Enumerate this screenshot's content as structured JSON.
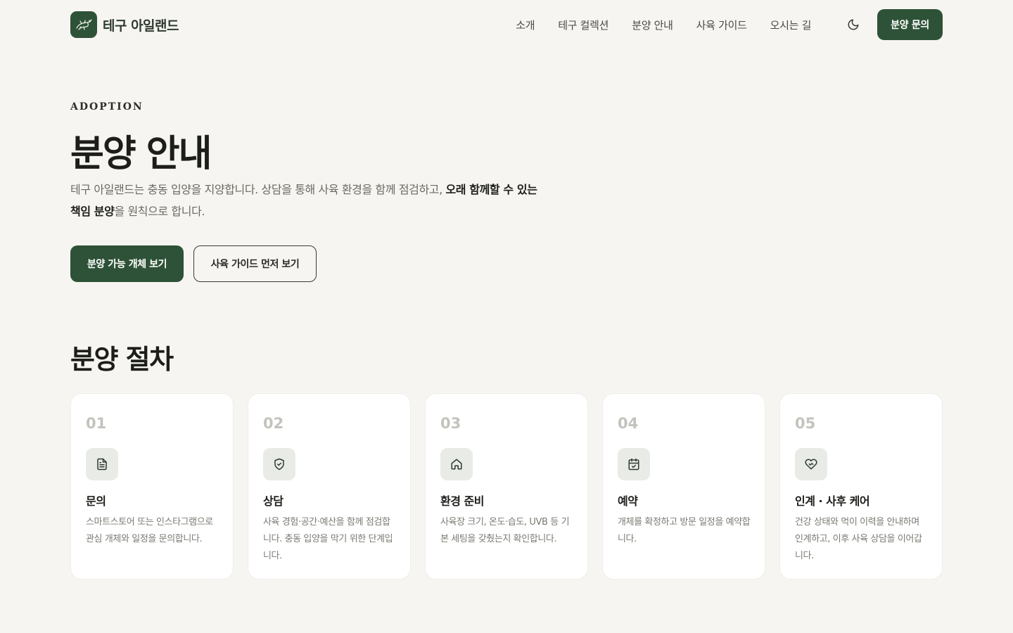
{
  "brand": {
    "name": "테구 아일랜드"
  },
  "nav": {
    "items": [
      {
        "label": "소개"
      },
      {
        "label": "테구 컬렉션"
      },
      {
        "label": "분양 안내"
      },
      {
        "label": "사육 가이드"
      },
      {
        "label": "오시는 길"
      }
    ],
    "theme_icon": "moon-icon",
    "cta_label": "분양 문의"
  },
  "hero": {
    "eyebrow": "ADOPTION",
    "title": "분양 안내",
    "desc_part1": "테구 아일랜드는 충동 입양을 지양합니다. 상담을 통해 사육 환경을 함께 점검하고, ",
    "desc_bold1": "오래 함께할 수 있는 책임 분양",
    "desc_part2": "을 원칙으로 합니다.",
    "primary_button": "분양 가능 개체 보기",
    "secondary_button": "사육 가이드 먼저 보기"
  },
  "process": {
    "title": "분양 절차",
    "steps": [
      {
        "num": "01",
        "icon": "document-icon",
        "title": "문의",
        "desc": "스마트스토어 또는 인스타그램으로 관심 개체와 일정을 문의합니다."
      },
      {
        "num": "02",
        "icon": "shield-check-icon",
        "title": "상담",
        "desc": "사육 경험·공간·예산을 함께 점검합니다. 충동 입양을 막기 위한 단계입니다."
      },
      {
        "num": "03",
        "icon": "home-icon",
        "title": "환경 준비",
        "desc": "사육장 크기, 온도·습도, UVB 등 기본 세팅을 갖췄는지 확인합니다."
      },
      {
        "num": "04",
        "icon": "calendar-check-icon",
        "title": "예약",
        "desc": "개체를 확정하고 방문 일정을 예약합니다."
      },
      {
        "num": "05",
        "icon": "handshake-heart-icon",
        "title": "인계 · 사후 케어",
        "desc": "건강 상태와 먹이 이력을 안내하며 인계하고, 이후 사육 상담을 이어갑니다."
      }
    ]
  },
  "colors": {
    "background": "#f6f5f1",
    "accent": "#2e5237",
    "card": "#ffffff",
    "icon_bg": "#e8ebe6"
  }
}
